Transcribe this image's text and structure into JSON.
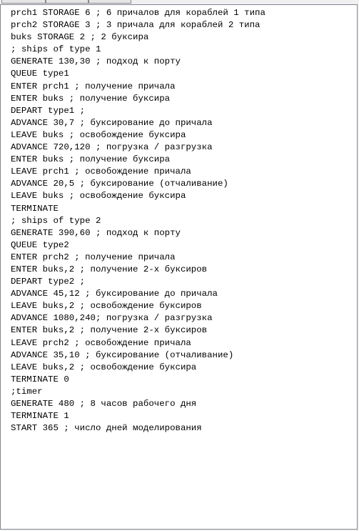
{
  "lines": [
    "prch1 STORAGE 6 ; 6 причалов для кораблей 1 типа",
    "prch2 STORAGE 3 ; 3 причала для кораблей 2 типа",
    "buks STORAGE 2 ; 2 буксира",
    "; ships of type 1",
    "GENERATE 130,30 ; подход к порту",
    "QUEUE type1",
    "ENTER prch1 ; получение причала",
    "ENTER buks ; получение буксира",
    "DEPART type1 ;",
    "ADVANCE 30,7 ; буксирование до причала",
    "LEAVE buks ; освобождение буксира",
    "ADVANCE 720,120 ; погрузка / разгрузка",
    "ENTER buks ; получение буксира",
    "LEAVE prch1 ; освобождение причала",
    "ADVANCE 20,5 ; буксирование (отчаливание)",
    "LEAVE buks ; освобождение буксира",
    "TERMINATE",
    "; ships of type 2",
    "GENERATE 390,60 ; подход к порту",
    "QUEUE type2",
    "ENTER prch2 ; получение причала",
    "ENTER buks,2 ; получение 2-х буксиров",
    "DEPART type2 ;",
    "ADVANCE 45,12 ; буксирование до причала",
    "LEAVE buks,2 ; освобождение буксиров",
    "ADVANCE 1080,240; погрузка / разгрузка",
    "ENTER buks,2 ; получение 2-х буксиров",
    "LEAVE prch2 ; освобождение причала",
    "ADVANCE 35,10 ; буксирование (отчаливание)",
    "LEAVE buks,2 ; освобождение буксира",
    "TERMINATE 0",
    ";timer",
    "GENERATE 480 ; 8 часов рабочего дня",
    "TERMINATE 1",
    "START 365 ; число дней моделирования"
  ]
}
